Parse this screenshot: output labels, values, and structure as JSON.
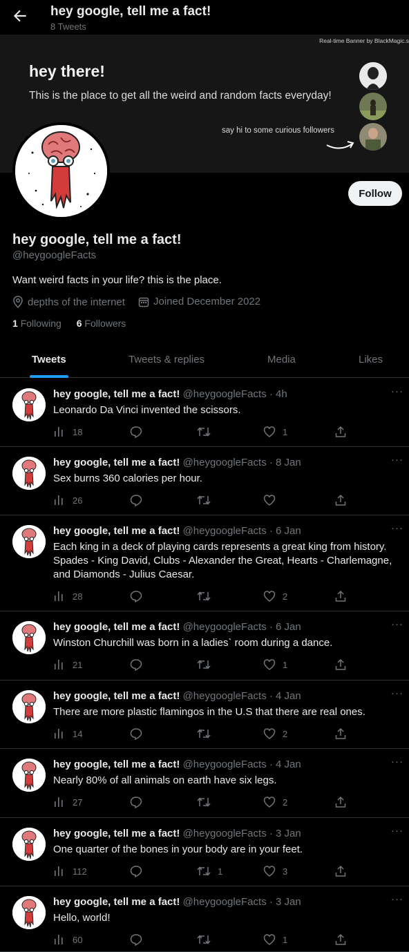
{
  "header": {
    "title": "hey google, tell me a fact!",
    "tweet_count": "8 Tweets"
  },
  "banner": {
    "credit": "Real-time Banner by BlackMagic.s",
    "heading": "hey there!",
    "subheading": "This is the place to get all the weird and random facts everyday!",
    "followers_caption": "say hi to some curious followers"
  },
  "profile": {
    "follow_label": "Follow",
    "name": "hey google, tell me a fact!",
    "handle": "@heygoogleFacts",
    "bio": "Want weird facts in your life? this is the place.",
    "location": "depths of the internet",
    "joined": "Joined December 2022",
    "following_count": "1",
    "following_label": "Following",
    "followers_count": "6",
    "followers_label": "Followers"
  },
  "tabs": [
    {
      "label": "Tweets"
    },
    {
      "label": "Tweets & replies"
    },
    {
      "label": "Media"
    },
    {
      "label": "Likes"
    }
  ],
  "tweets": [
    {
      "name": "hey google, tell me a fact!",
      "handle": "@heygoogleFacts",
      "time": "4h",
      "text": "Leonardo Da Vinci invented the scissors.",
      "views": "18",
      "replies": "",
      "retweets": "",
      "likes": "1"
    },
    {
      "name": "hey google, tell me a fact!",
      "handle": "@heygoogleFacts",
      "time": "8 Jan",
      "text": "Sex burns 360 calories per hour.",
      "views": "26",
      "replies": "",
      "retweets": "",
      "likes": ""
    },
    {
      "name": "hey google, tell me a fact!",
      "handle": "@heygoogleFacts",
      "time": "6 Jan",
      "text": "Each king in a deck of playing cards represents a great king from history. Spades - King David, Clubs - Alexander the Great, Hearts - Charlemagne, and Diamonds - Julius Caesar.",
      "views": "28",
      "replies": "",
      "retweets": "",
      "likes": "2"
    },
    {
      "name": "hey google, tell me a fact!",
      "handle": "@heygoogleFacts",
      "time": "6 Jan",
      "text": "Winston Churchill was born in a ladies` room during a dance.",
      "views": "21",
      "replies": "",
      "retweets": "",
      "likes": "1"
    },
    {
      "name": "hey google, tell me a fact!",
      "handle": "@heygoogleFacts",
      "time": "4 Jan",
      "text": "There are more plastic flamingos in the U.S that there are real ones.",
      "views": "14",
      "replies": "",
      "retweets": "",
      "likes": "2"
    },
    {
      "name": "hey google, tell me a fact!",
      "handle": "@heygoogleFacts",
      "time": "4 Jan",
      "text": "Nearly 80% of all animals on earth have six legs.",
      "views": "27",
      "replies": "",
      "retweets": "",
      "likes": "2"
    },
    {
      "name": "hey google, tell me a fact!",
      "handle": "@heygoogleFacts",
      "time": "3 Jan",
      "text": "One quarter of the bones in your body are in your feet.",
      "views": "112",
      "replies": "",
      "retweets": "1",
      "likes": "3"
    },
    {
      "name": "hey google, tell me a fact!",
      "handle": "@heygoogleFacts",
      "time": "3 Jan",
      "text": "Hello, world!",
      "views": "60",
      "replies": "",
      "retweets": "",
      "likes": "1"
    }
  ],
  "icons": {
    "back": "arrow-left-icon",
    "location": "location-pin-icon",
    "calendar": "calendar-icon",
    "views": "views-icon",
    "reply": "reply-icon",
    "retweet": "retweet-icon",
    "like": "heart-icon",
    "share": "share-icon",
    "more": "more-icon"
  },
  "colors": {
    "accent": "#1d9bf0",
    "background": "#000000",
    "text": "#e7e9ea",
    "muted": "#71767b",
    "divider": "#2f3336"
  }
}
